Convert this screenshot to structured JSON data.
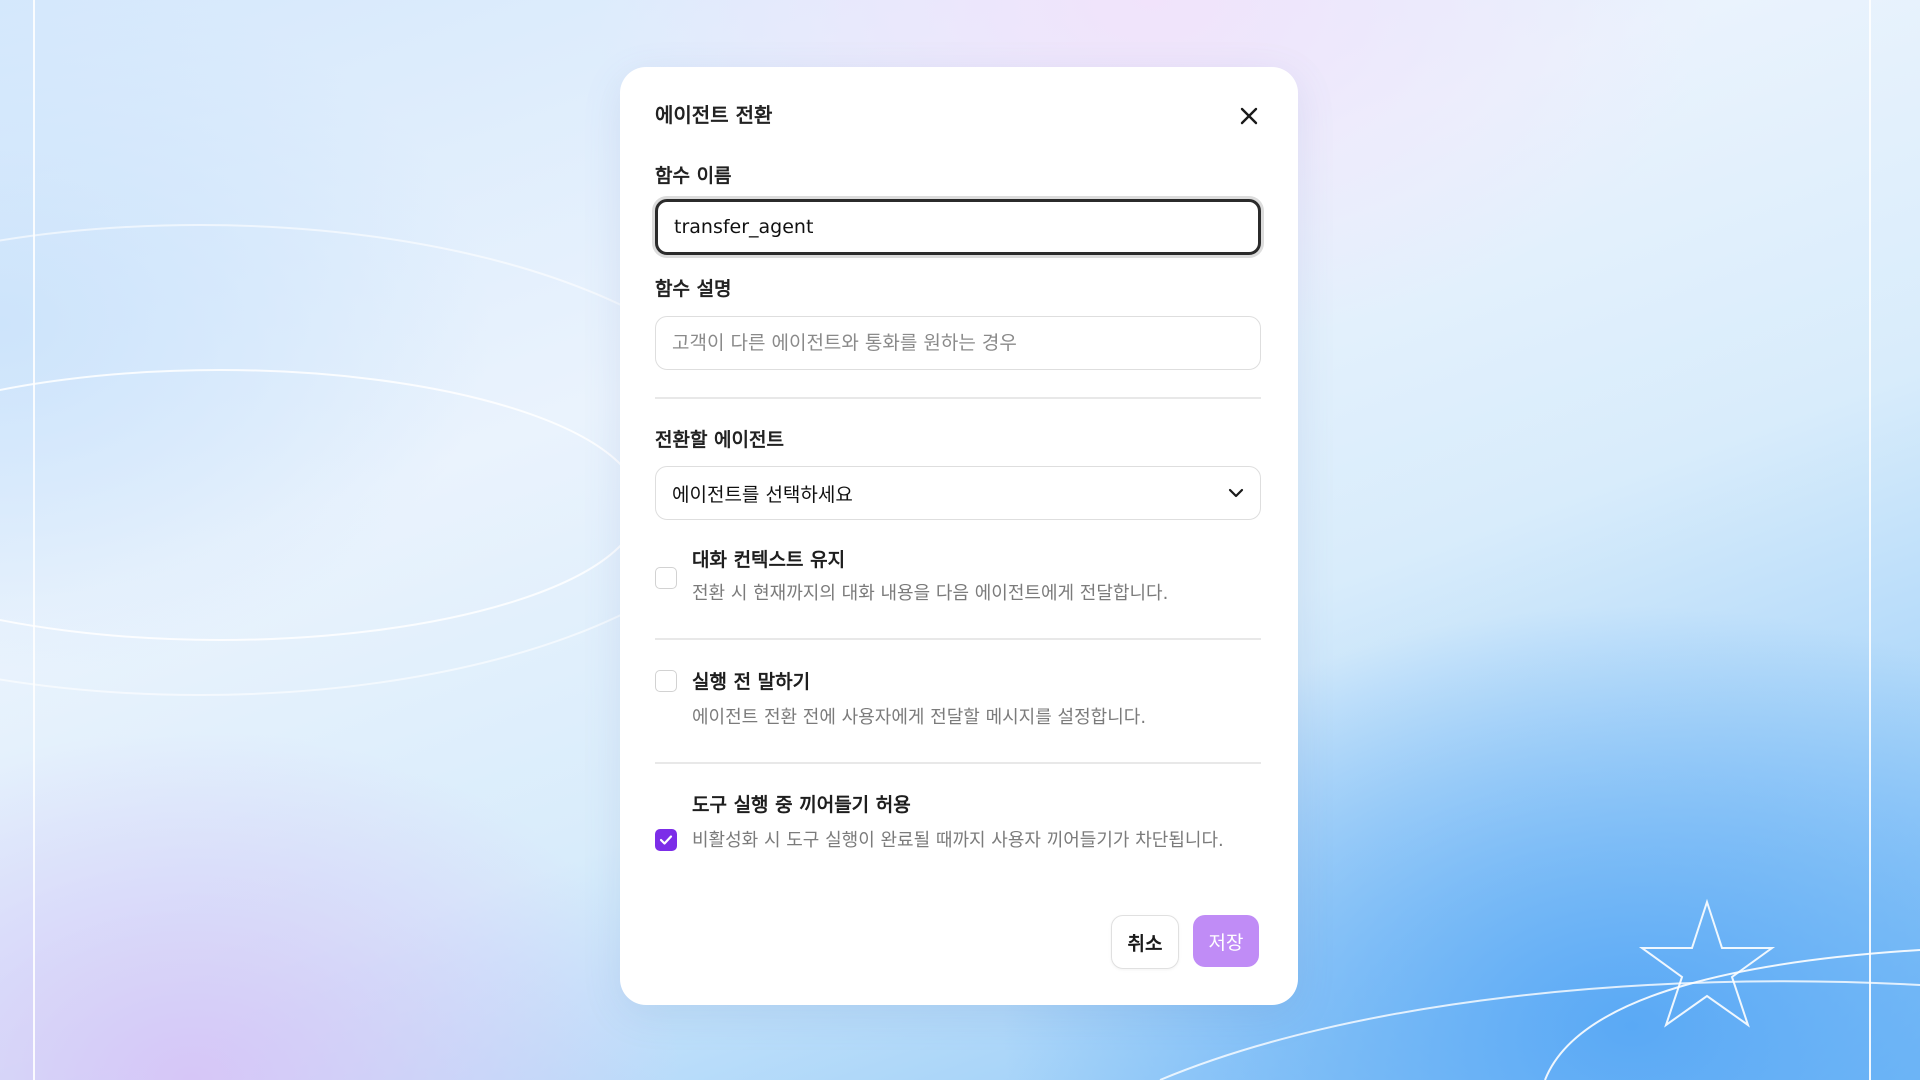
{
  "dialog": {
    "title": "에이전트 전환",
    "close_icon": "close-icon"
  },
  "function_name": {
    "label": "함수 이름",
    "value": "transfer_agent"
  },
  "function_description": {
    "label": "함수 설명",
    "placeholder": "고객이 다른 에이전트와 통화를 원하는 경우"
  },
  "target_agent": {
    "label": "전환할 에이전트",
    "selected": "에이전트를 선택하세요",
    "chevron_icon": "chevron-down-icon"
  },
  "options": [
    {
      "title": "대화 컨텍스트 유지",
      "description": "전환 시 현재까지의 대화 내용을 다음 에이전트에게 전달합니다.",
      "checked": false
    },
    {
      "title": "실행 전 말하기",
      "description": "에이전트 전환 전에 사용자에게 전달할 메시지를 설정합니다.",
      "checked": false
    },
    {
      "title": "도구 실행 중 끼어들기 허용",
      "description": "비활성화 시 도구 실행이 완료될 때까지 사용자 끼어들기가 차단됩니다.",
      "checked": true
    }
  ],
  "actions": {
    "cancel_label": "취소",
    "save_label": "저장"
  },
  "colors": {
    "accent": "#7c2de8",
    "save_button_disabled": "#c08cf6"
  }
}
